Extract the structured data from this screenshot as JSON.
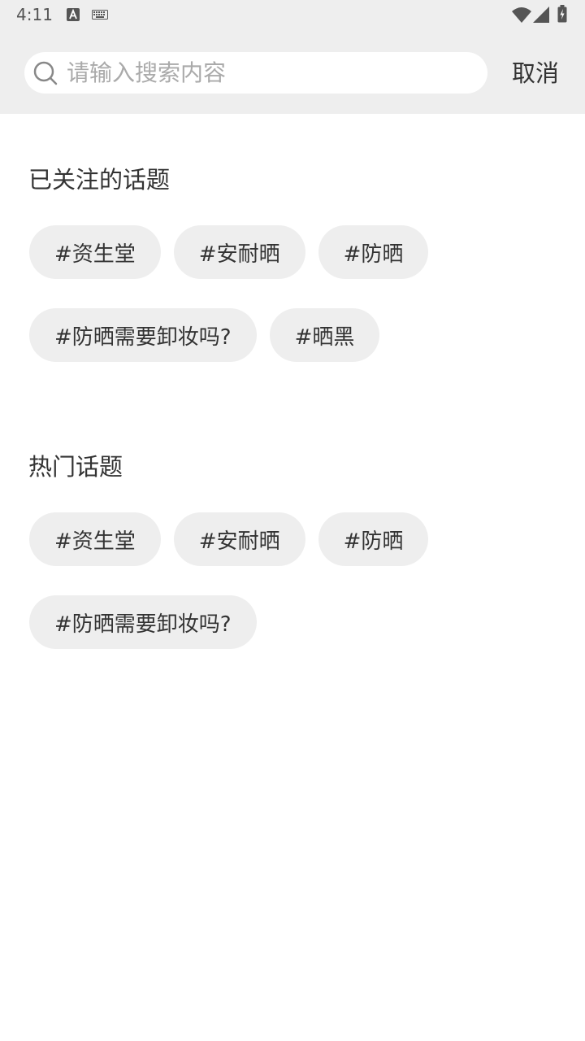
{
  "status_bar": {
    "time": "4:11",
    "icons": [
      "text-a-icon",
      "keyboard-icon",
      "wifi-icon",
      "signal-icon",
      "battery-charging-icon"
    ]
  },
  "search": {
    "placeholder": "请输入搜索内容",
    "value": "",
    "cancel_label": "取消"
  },
  "followed_topics": {
    "title": "已关注的话题",
    "rows": [
      [
        "#资生堂",
        "#安耐晒",
        "#防晒"
      ],
      [
        "#防晒需要卸妆吗?",
        "#晒黑"
      ]
    ]
  },
  "hot_topics": {
    "title": "热门话题",
    "rows": [
      [
        "#资生堂",
        "#安耐晒",
        "#防晒"
      ],
      [
        "#防晒需要卸妆吗?"
      ]
    ]
  },
  "colors": {
    "header_bg": "#eeeeee",
    "chip_bg": "#eeeeee",
    "text": "#333333",
    "placeholder": "#aaaaaa"
  }
}
